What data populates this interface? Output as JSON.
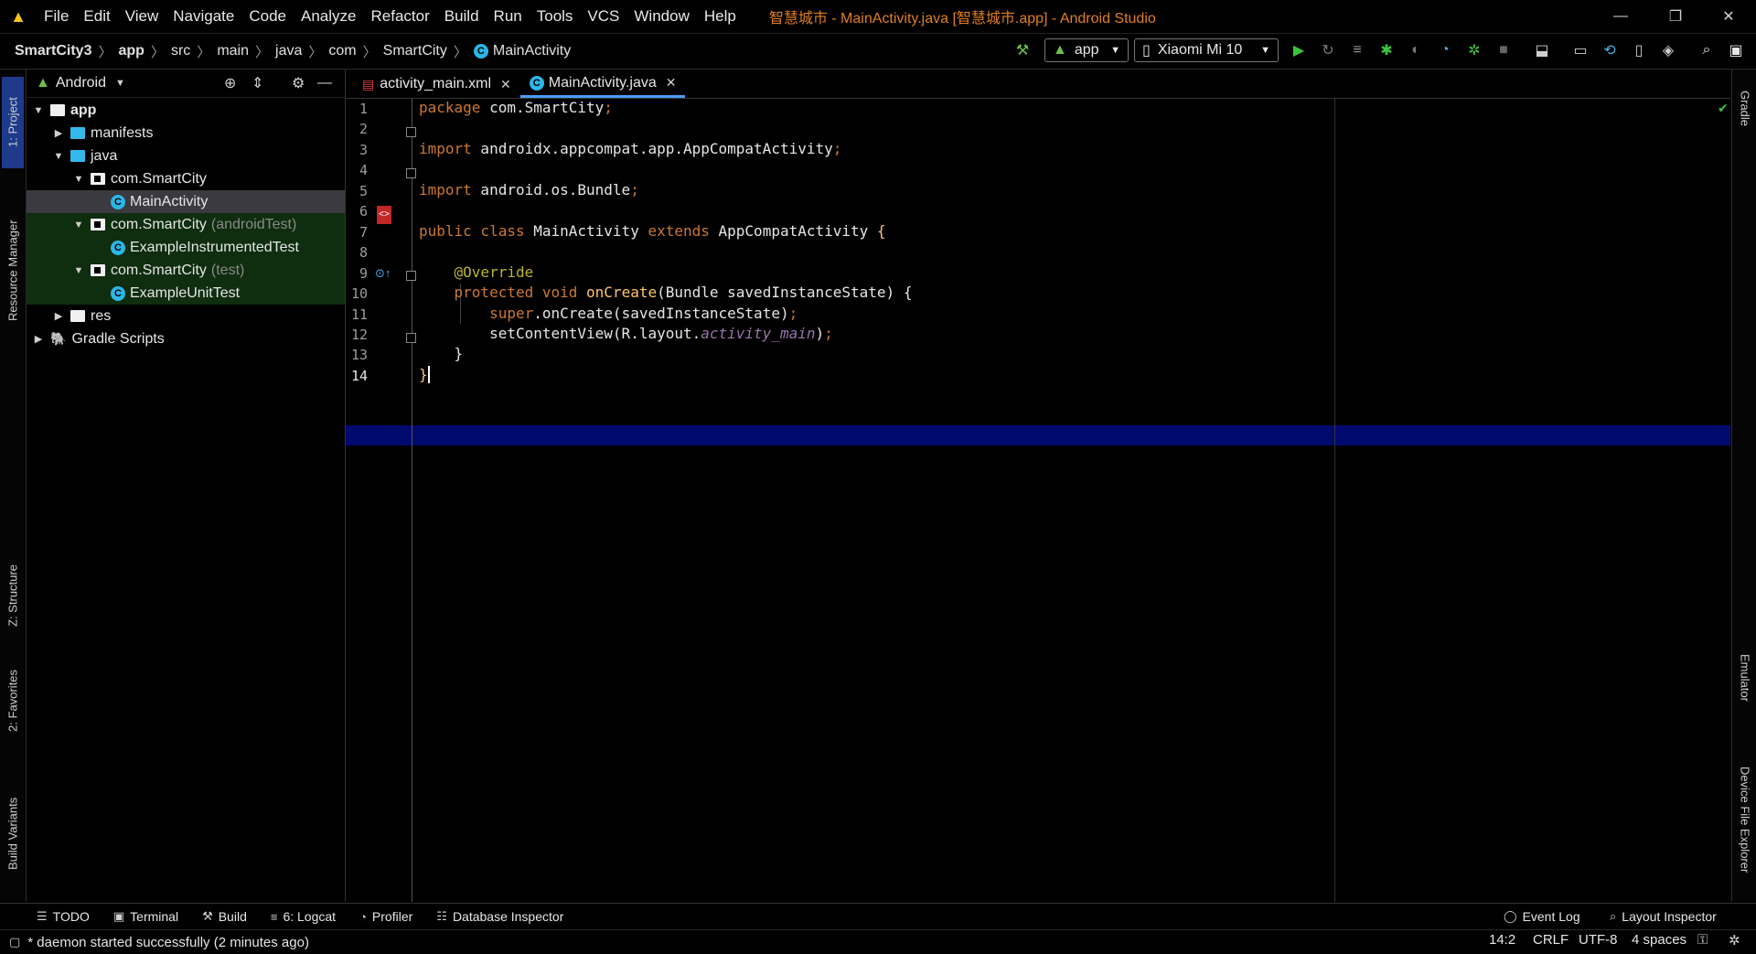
{
  "menu": {
    "items": [
      "File",
      "Edit",
      "View",
      "Navigate",
      "Code",
      "Analyze",
      "Refactor",
      "Build",
      "Run",
      "Tools",
      "VCS",
      "Window",
      "Help"
    ],
    "title": "智慧城市 - MainActivity.java [智慧城市.app] - Android Studio"
  },
  "breadcrumbs": [
    "SmartCity3",
    "app",
    "src",
    "main",
    "java",
    "com",
    "SmartCity",
    "MainActivity"
  ],
  "toolbar": {
    "config": "app",
    "device": "Xiaomi Mi 10"
  },
  "left_tabs": [
    "1: Project",
    "Resource Manager",
    "Z: Structure",
    "2: Favorites",
    "Build Variants"
  ],
  "right_tabs": [
    "Gradle",
    "Emulator",
    "Device File Explorer"
  ],
  "project": {
    "view": "Android",
    "tree": [
      {
        "label": "app",
        "suffix": "",
        "depth": 0,
        "arrow": "▼",
        "icon": "app-folder"
      },
      {
        "label": "manifests",
        "suffix": "",
        "depth": 1,
        "arrow": "▶",
        "icon": "folder"
      },
      {
        "label": "java",
        "suffix": "",
        "depth": 1,
        "arrow": "▼",
        "icon": "folder"
      },
      {
        "label": "com.SmartCity",
        "suffix": "",
        "depth": 2,
        "arrow": "▼",
        "icon": "package"
      },
      {
        "label": "MainActivity",
        "suffix": "",
        "depth": 3,
        "arrow": "",
        "icon": "class"
      },
      {
        "label": "com.SmartCity",
        "suffix": "(androidTest)",
        "depth": 2,
        "arrow": "▼",
        "icon": "package"
      },
      {
        "label": "ExampleInstrumentedTest",
        "suffix": "",
        "depth": 3,
        "arrow": "",
        "icon": "class"
      },
      {
        "label": "com.SmartCity",
        "suffix": "(test)",
        "depth": 2,
        "arrow": "▼",
        "icon": "package"
      },
      {
        "label": "ExampleUnitTest",
        "suffix": "",
        "depth": 3,
        "arrow": "",
        "icon": "class"
      },
      {
        "label": "res",
        "suffix": "",
        "depth": 1,
        "arrow": "▶",
        "icon": "res-folder"
      },
      {
        "label": "Gradle Scripts",
        "suffix": "",
        "depth": 0,
        "arrow": "▶",
        "icon": "gradle"
      }
    ]
  },
  "tabs": [
    {
      "label": "activity_main.xml",
      "active": false
    },
    {
      "label": "MainActivity.java",
      "active": true
    }
  ],
  "code": {
    "line_numbers": [
      "1",
      "2",
      "3",
      "4",
      "5",
      "6",
      "7",
      "8",
      "9",
      "10",
      "11",
      "12",
      "13",
      "14"
    ],
    "current_line": "14"
  },
  "bottom_tools": [
    {
      "label": "TODO",
      "icon": "list-icon"
    },
    {
      "label": "Terminal",
      "icon": "terminal-icon"
    },
    {
      "label": "Build",
      "icon": "hammer-icon"
    },
    {
      "label": "6: Logcat",
      "icon": "logcat-icon"
    },
    {
      "label": "Profiler",
      "icon": "profiler-icon"
    },
    {
      "label": "Database Inspector",
      "icon": "database-icon"
    }
  ],
  "bottom_right_tools": [
    "Event Log",
    "Layout Inspector"
  ],
  "status": {
    "message": "* daemon started successfully (2 minutes ago)",
    "position": "14:2",
    "line_sep": "CRLF",
    "encoding": "UTF-8",
    "indent": "4 spaces"
  }
}
